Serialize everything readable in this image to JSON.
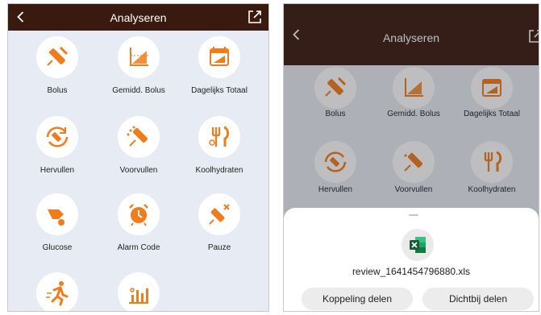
{
  "colors": {
    "header_bg": "#3a1a0e",
    "accent": "#f07c1b",
    "screen_bg": "#e7ebf3"
  },
  "left_screen": {
    "title": "Analyseren",
    "back_icon": "chevron-left-icon",
    "export_icon": "export-icon",
    "tiles": [
      {
        "label": "Bolus",
        "icon": "syringe-icon"
      },
      {
        "label": "Gemidd. Bolus",
        "icon": "average-chart-icon"
      },
      {
        "label": "Dagelijks Totaal",
        "icon": "calendar-icon"
      },
      {
        "label": "Hervullen",
        "icon": "refill-icon"
      },
      {
        "label": "Voorvullen",
        "icon": "prime-syringe-icon"
      },
      {
        "label": "Koolhydraten",
        "icon": "fork-knife-icon"
      },
      {
        "label": "Glucose",
        "icon": "blood-drop-icon"
      },
      {
        "label": "Alarm Code",
        "icon": "alarm-clock-icon"
      },
      {
        "label": "Pauze",
        "icon": "pause-syringe-icon"
      },
      {
        "label": "",
        "icon": "running-icon"
      },
      {
        "label": "",
        "icon": "bar-chart-icon"
      }
    ]
  },
  "right_screen": {
    "title": "Analyseren",
    "tiles": [
      {
        "label": "Bolus"
      },
      {
        "label": "Gemidd. Bolus"
      },
      {
        "label": "Dagelijks Totaal"
      },
      {
        "label": "Hervullen"
      },
      {
        "label": "Voorvullen"
      },
      {
        "label": "Koolhydraten"
      }
    ],
    "share_sheet": {
      "file_icon": "excel-icon",
      "filename": "review_1641454796880.xls",
      "share_link_label": "Koppeling delen",
      "share_nearby_label": "Dichtbij delen"
    }
  }
}
